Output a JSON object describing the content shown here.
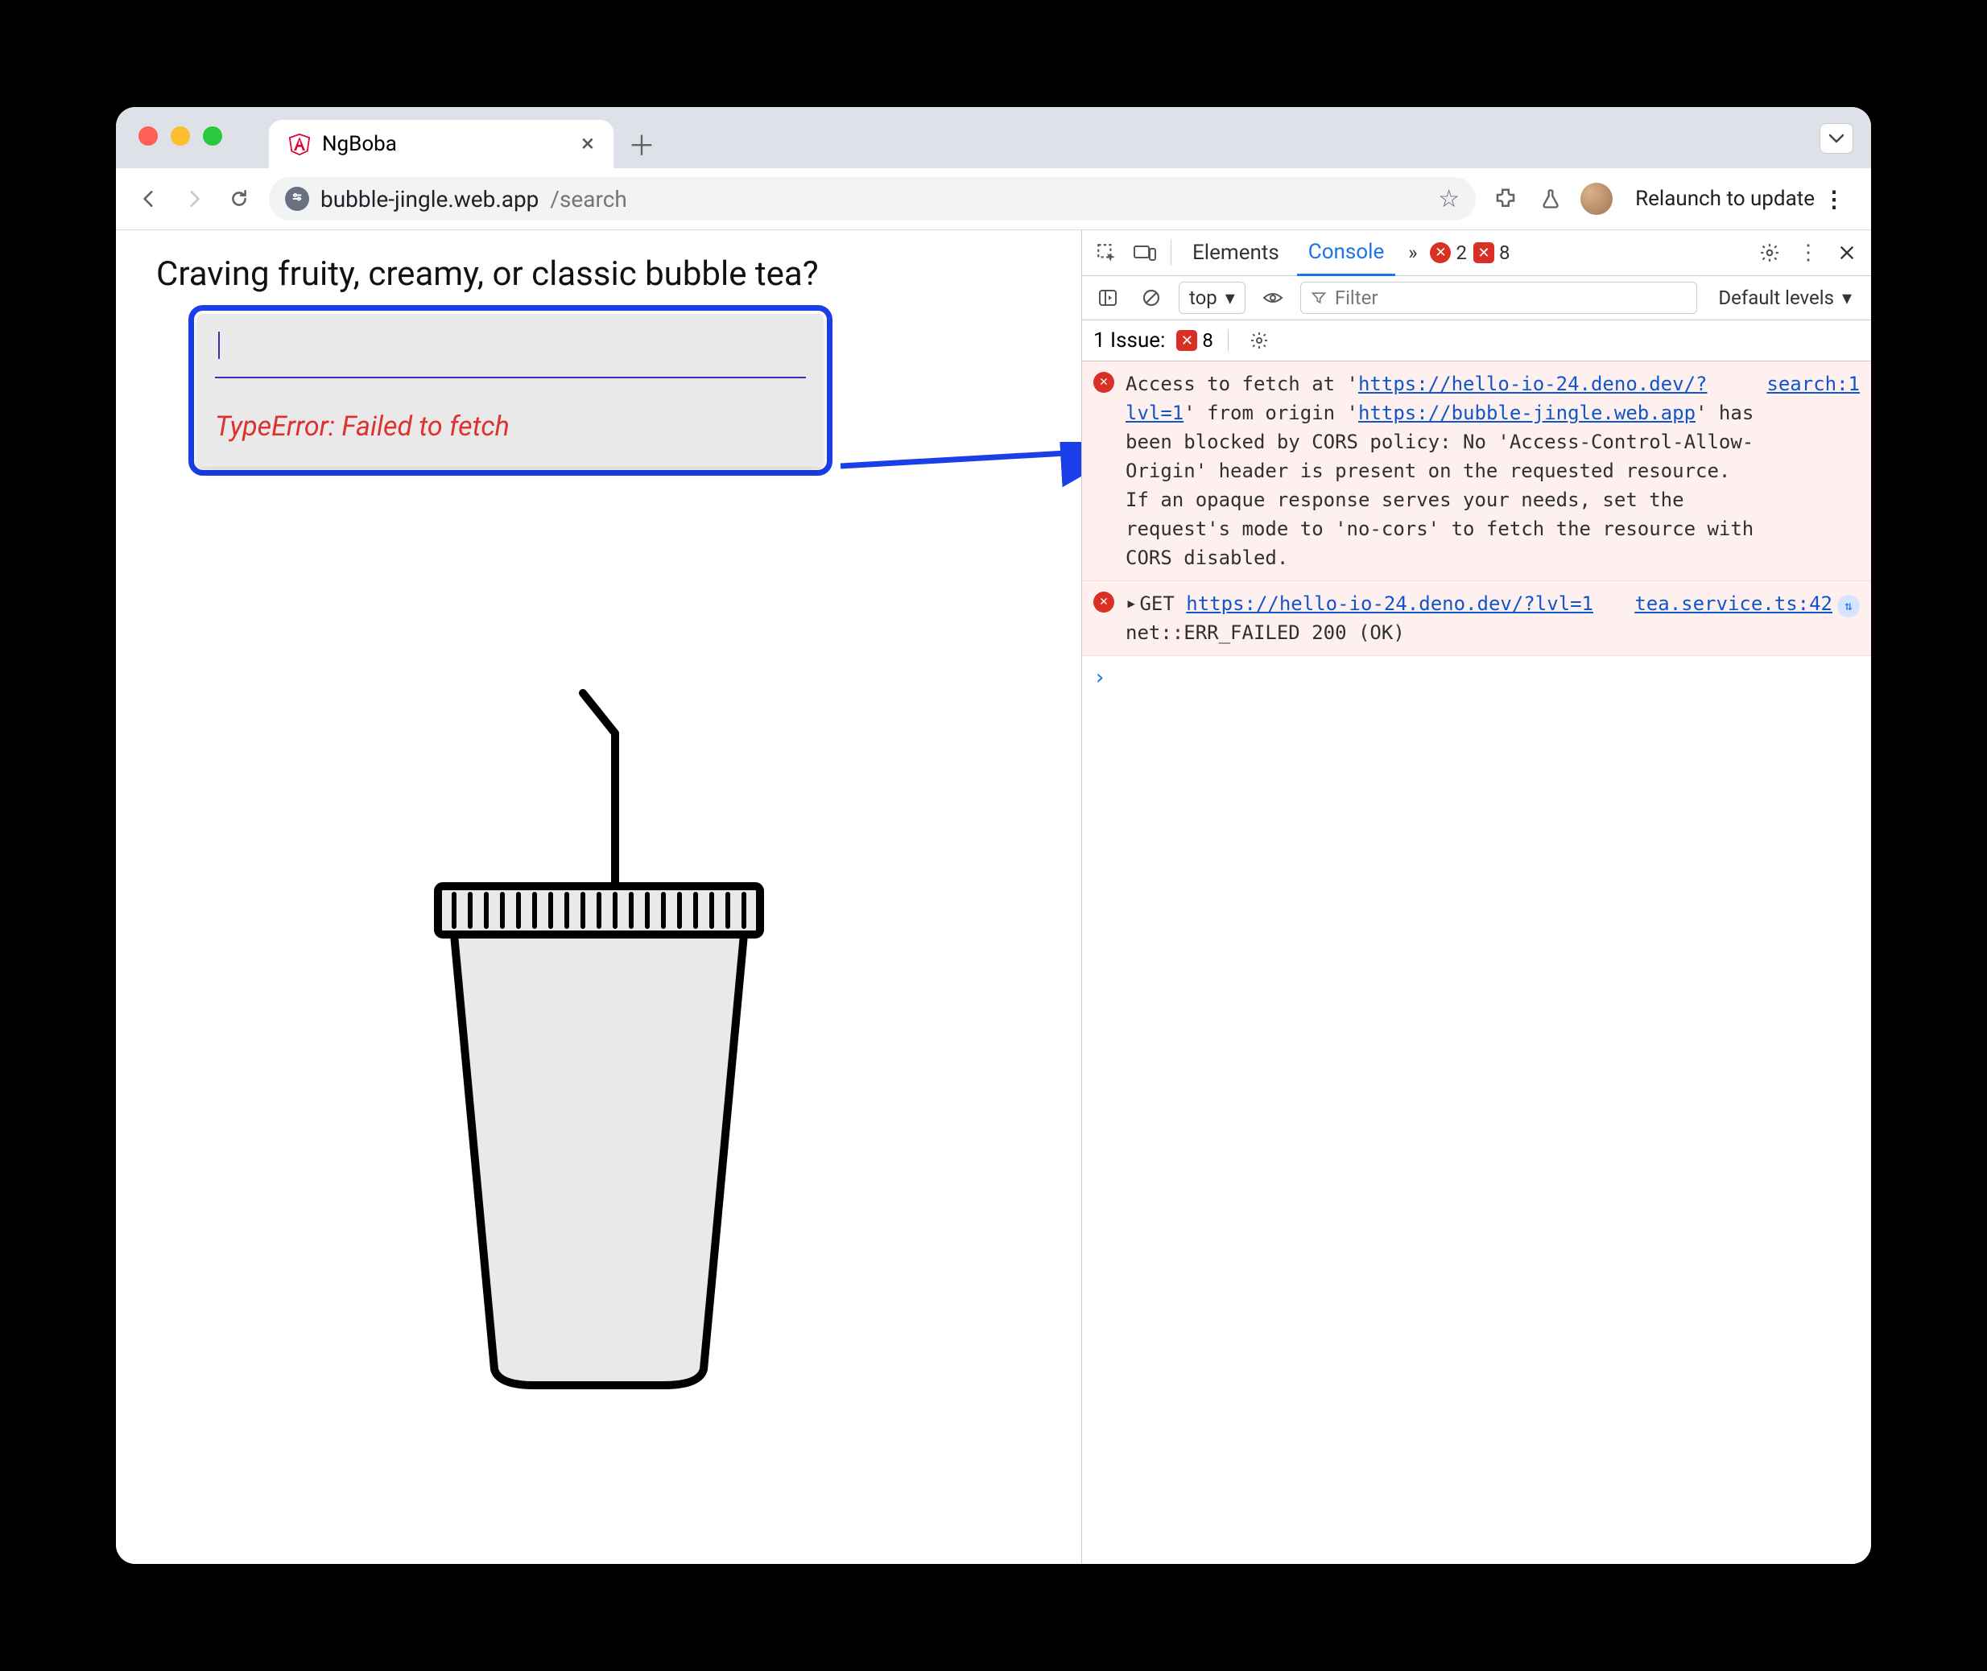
{
  "browser": {
    "tab_title": "NgBoba",
    "url_host": "bubble-jingle.web.app",
    "url_path": "/search",
    "relaunch_label": "Relaunch to update"
  },
  "page": {
    "heading": "Craving fruity, creamy, or classic bubble tea?",
    "input_value": "",
    "error_text": "TypeError: Failed to fetch"
  },
  "devtools": {
    "tabs": {
      "elements": "Elements",
      "console": "Console"
    },
    "error_count": "2",
    "issue_count_top": "8",
    "controls": {
      "context": "top",
      "filter_placeholder": "Filter",
      "levels_label": "Default levels"
    },
    "issuebar": {
      "label": "1 Issue:",
      "count": "8"
    },
    "messages": {
      "m0": {
        "source": "search:1",
        "pre": "Access to fetch at '",
        "url1": "https://hello-io-24.deno.dev/?lvl=1",
        "mid1": "' from origin '",
        "url2": "https://bubble-jingle.web.app",
        "tail": "' has been blocked by CORS policy: No 'Access-Control-Allow-Origin' header is present on the requested resource. If an opaque response serves your needs, set the request's mode to 'no-cors' to fetch the resource with CORS disabled."
      },
      "m1": {
        "source": "tea.service.ts:42",
        "method": "GET",
        "url": "https://hello-io-24.deno.dev/?lvl=1",
        "status": " net::ERR_FAILED 200 (OK)"
      }
    },
    "prompt": "›"
  }
}
